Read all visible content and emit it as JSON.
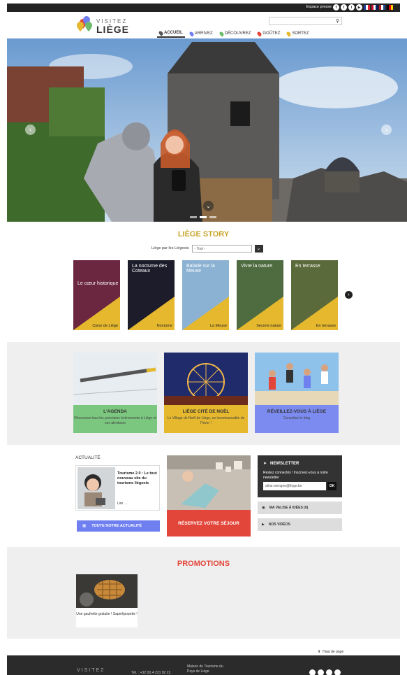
{
  "topbar": {
    "press_label": "Espace presse",
    "socials": [
      "f",
      "t",
      "i",
      "▶"
    ],
    "flags": [
      {
        "name": "fr",
        "colors": [
          "#1f3f9b",
          "#ffffff",
          "#e2212e"
        ]
      },
      {
        "name": "en",
        "colors": [
          "#c8102e",
          "#ffffff",
          "#012169"
        ]
      },
      {
        "name": "nl",
        "colors": [
          "#ae1c28",
          "#ffffff",
          "#21468b"
        ]
      },
      {
        "name": "de",
        "colors": [
          "#000000",
          "#dd0000",
          "#ffce00"
        ]
      }
    ]
  },
  "search": {
    "placeholder": "",
    "icon": "search-icon"
  },
  "logo": {
    "line1": "VISITEZ",
    "line2": "LIÈGE"
  },
  "nav": [
    {
      "label": "ACCUEIL",
      "color": "#555555",
      "active": true
    },
    {
      "label": "ARRIVEZ",
      "color": "#6f7ff0"
    },
    {
      "label": "DÉCOUVREZ",
      "color": "#6dbb6b"
    },
    {
      "label": "GOÛTEZ",
      "color": "#e2463a"
    },
    {
      "label": "SORTEZ",
      "color": "#e5b82e"
    }
  ],
  "story": {
    "title": "LIÈGE STORY",
    "filter_label": "Liège par les Liégeois",
    "filter_value": "- Tout -",
    "cards": [
      {
        "label": "Cœur de Liège",
        "overlay": "Le cœur historique",
        "bg": "#6b2740"
      },
      {
        "label": "Nocturne",
        "overlay": "La nocturne des Coteaux",
        "bg": "#1d1c2a"
      },
      {
        "label": "La Meuse",
        "overlay": "Balade sur la Meuse",
        "bg": "#8bb2d3"
      },
      {
        "label": "Secrets nature",
        "overlay": "Vivre la nature",
        "bg": "#4f6c40"
      },
      {
        "label": "En terrasse",
        "overlay": "En terrasse",
        "bg": "#5b6a3a"
      }
    ]
  },
  "features": [
    {
      "title": "L'AGENDA",
      "subtitle": "Découvrez tous les prochains événements à Liège et ses alentours",
      "color": "#7bc77f"
    },
    {
      "title": "LIÈGE CITÉ DE NOËL",
      "subtitle": "Le Village de Noël de Liège, un incontournable de l'hiver !",
      "color": "#e5b82e"
    },
    {
      "title": "RÉVEILLEZ-VOUS À LIÈGE",
      "subtitle": "Consultez le blog",
      "color": "#7c8bf0"
    }
  ],
  "actualite": {
    "title": "ACTUALITÉ",
    "news_title": "Tourisme 2.0 : Le tout nouveau site du tourisme liégeois",
    "more": "Lire →",
    "all_label": "TOUTE NOTRE ACTUALITÉ"
  },
  "sejour": {
    "label": "RÉSERVEZ VOTRE SÉJOUR"
  },
  "newsletter": {
    "title": "NEWSLETTER",
    "desc": "Restez connectés ! Inscrivez-vous à notre newsletter",
    "value": "aline.mengee@liege.be",
    "ok": "OK"
  },
  "side_buttons": [
    {
      "label": "MA VALISE À IDÉES (0)"
    },
    {
      "label": "NOS VIDÉOS"
    }
  ],
  "promotions": {
    "title": "PROMOTIONS",
    "item": "Une gaufrette gratuite ! Saperlipopette !"
  },
  "back_top": "Haut de page",
  "footer": {
    "logo": "VISITEZ",
    "tel": "Tél. : +32 (0) 4 221 92 21",
    "addr1": "Maison du Tourisme du",
    "addr2": "Pays de Liège"
  }
}
